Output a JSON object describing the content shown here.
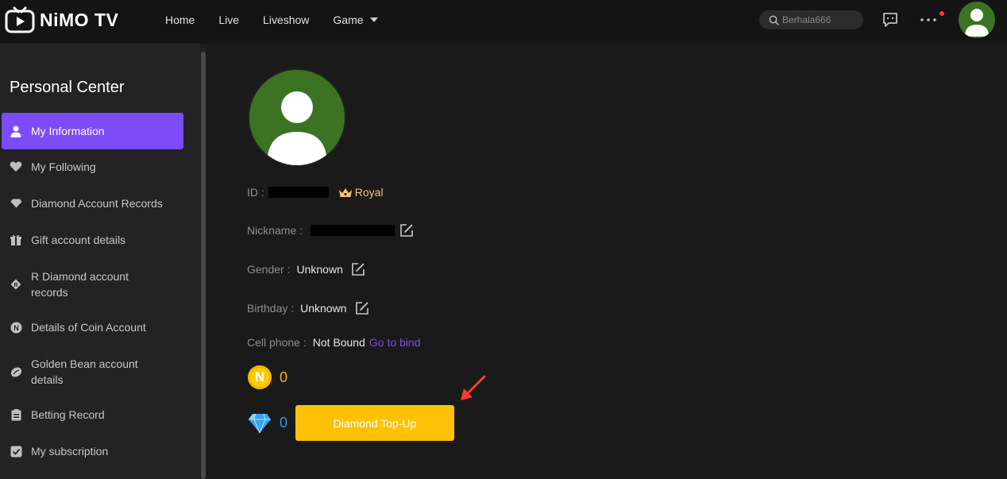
{
  "app": {
    "logo_text": "NiMO TV"
  },
  "nav": {
    "home": "Home",
    "live": "Live",
    "liveshow": "Liveshow",
    "game": "Game"
  },
  "search": {
    "placeholder": "Berhala666"
  },
  "sidebar": {
    "title": "Personal Center",
    "items": [
      {
        "label": "My Information",
        "icon": "user-icon"
      },
      {
        "label": "My Following",
        "icon": "heart-icon"
      },
      {
        "label": "Diamond Account Records",
        "icon": "diamond-icon"
      },
      {
        "label": "Gift account details",
        "icon": "gift-icon"
      },
      {
        "label": "R Diamond account records",
        "icon": "r-diamond-icon"
      },
      {
        "label": "Details of Coin Account",
        "icon": "coin-icon"
      },
      {
        "label": "Golden Bean account details",
        "icon": "bean-icon"
      },
      {
        "label": "Betting Record",
        "icon": "clipboard-icon"
      },
      {
        "label": "My subscription",
        "icon": "check-badge-icon"
      }
    ]
  },
  "profile": {
    "id_label": "ID :",
    "royal_label": "Royal",
    "nickname_label": "Nickname :",
    "gender_label": "Gender :",
    "gender_value": "Unknown",
    "birthday_label": "Birthday :",
    "birthday_value": "Unknown",
    "phone_label": "Cell phone :",
    "phone_value": "Not Bound",
    "bind_link": "Go to bind",
    "coin_count": "0",
    "diamond_count": "0",
    "topup_label": "Diamond Top-Up"
  },
  "colors": {
    "accent": "#7b4cf7",
    "topup": "#ffc107",
    "royal": "#f2c37a",
    "coin": "#ffb300",
    "diamond": "#2d9bf0",
    "arrow": "#ff3b30"
  }
}
